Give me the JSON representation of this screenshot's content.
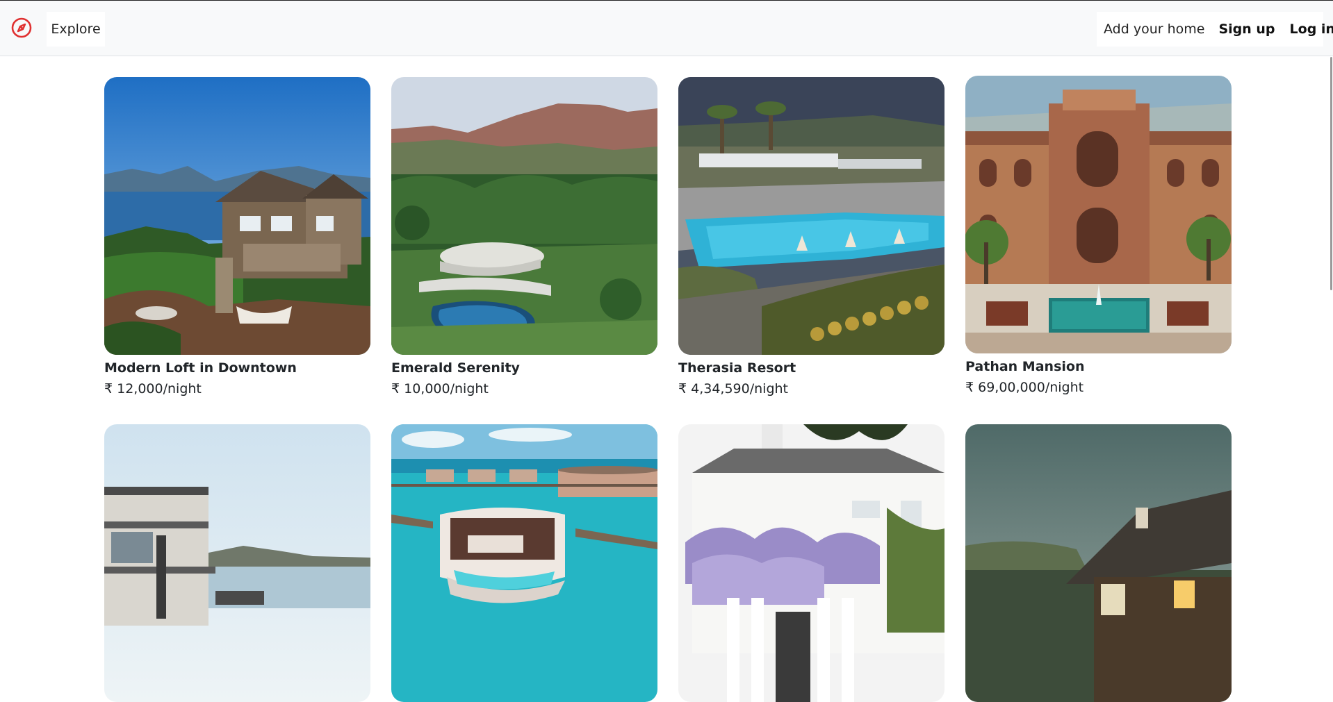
{
  "navbar": {
    "brand_icon": "compass-icon",
    "explore_label": "Explore",
    "add_home_label": "Add your home",
    "signup_label": "Sign up",
    "login_label": "Log in",
    "accent_color": "#e03131"
  },
  "listings": [
    {
      "title": "Modern Loft in Downtown",
      "price": "₹ 12,000/night",
      "image": "lakeside-house"
    },
    {
      "title": "Emerald Serenity",
      "price": "₹ 10,000/night",
      "image": "forest-villa"
    },
    {
      "title": "Therasia Resort",
      "price": "₹ 4,34,590/night",
      "image": "resort-pool"
    },
    {
      "title": "Pathan Mansion",
      "price": "₹ 69,00,000/night",
      "image": "palace-mansion"
    },
    {
      "title": "",
      "price": "",
      "image": "seaside-villa"
    },
    {
      "title": "",
      "price": "",
      "image": "overwater-bungalow"
    },
    {
      "title": "",
      "price": "",
      "image": "wisteria-mansion"
    },
    {
      "title": "",
      "price": "",
      "image": "thatched-cottage"
    }
  ]
}
